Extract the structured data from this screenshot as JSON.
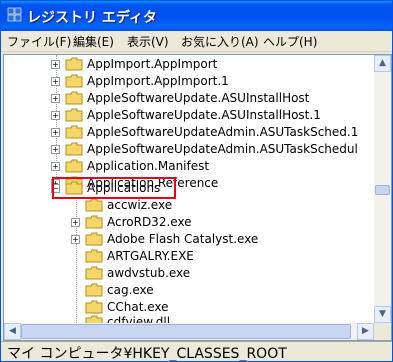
{
  "window": {
    "title": "レジストリ エディタ"
  },
  "menu": [
    "ファイル(F)",
    "編集(E)",
    "表示(V)",
    "お気に入り(A)",
    "ヘルプ(H)"
  ],
  "tree": {
    "parents": [
      "AppImport.AppImport",
      "AppImport.AppImport.1",
      "AppleSoftwareUpdate.ASUInstallHost",
      "AppleSoftwareUpdate.ASUInstallHost.1",
      "AppleSoftwareUpdateAdmin.ASUTaskSched.1",
      "AppleSoftwareUpdateAdmin.ASUTaskSchedul",
      "Application.Manifest",
      "Application.Reference"
    ],
    "selected": "Applications",
    "children": [
      "accwiz.exe",
      "AcroRD32.exe",
      "Adobe Flash Catalyst.exe",
      "ARTGALRY.EXE",
      "awdvstub.exe",
      "cag.exe",
      "CChat.exe",
      "cdfview.dll"
    ]
  },
  "status": "マイ コンピュータ¥HKEY_CLASSES_ROOT",
  "colors": {
    "highlight_border": "#e8001c",
    "titlebar": "#0054e3",
    "folder": "#f5d769"
  }
}
